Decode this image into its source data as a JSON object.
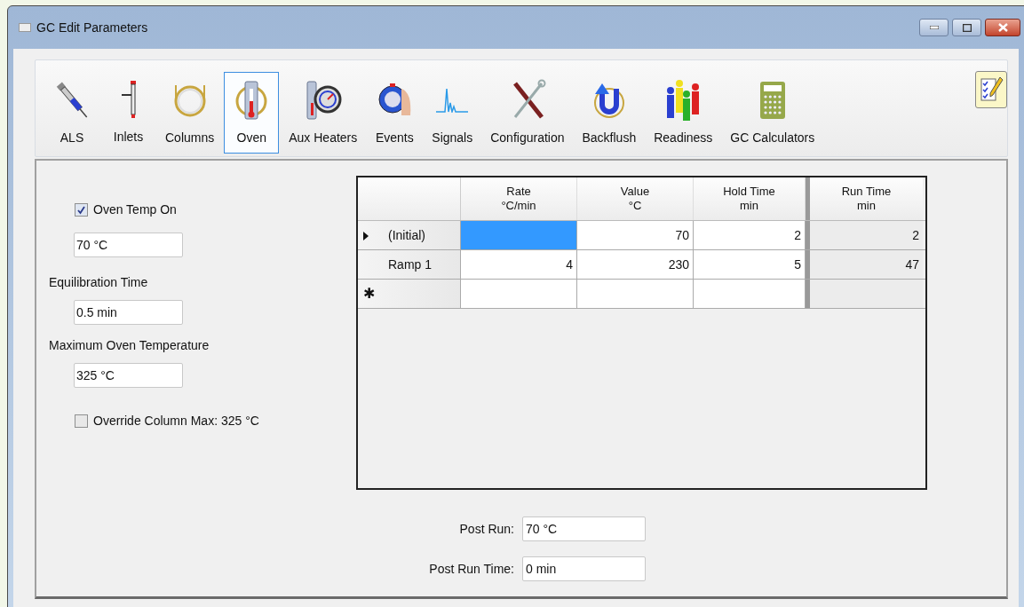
{
  "window": {
    "title": "GC Edit Parameters"
  },
  "toolbar": [
    {
      "label": "ALS",
      "selected": false
    },
    {
      "label": "Inlets",
      "selected": false
    },
    {
      "label": "Columns",
      "selected": false
    },
    {
      "label": "Oven",
      "selected": true
    },
    {
      "label": "Aux Heaters",
      "selected": false
    },
    {
      "label": "Events",
      "selected": false
    },
    {
      "label": "Signals",
      "selected": false
    },
    {
      "label": "Configuration",
      "selected": false
    },
    {
      "label": "Backflush",
      "selected": false
    },
    {
      "label": "Readiness",
      "selected": false
    },
    {
      "label": "GC Calculators",
      "selected": false
    }
  ],
  "oven": {
    "oven_temp_on": {
      "label": "Oven Temp On",
      "checked": true
    },
    "oven_temp": {
      "value": "70 °C"
    },
    "equilibration_time": {
      "label": "Equilibration Time",
      "value": "0.5 min"
    },
    "max_oven_temperature": {
      "label": "Maximum Oven Temperature",
      "value": "325 °C"
    },
    "override_column_max": {
      "label": "Override Column Max: 325 °C",
      "checked": false
    }
  },
  "ramp_table": {
    "columns": [
      {
        "title": "Rate",
        "unit": "°C/min",
        "readonly": false
      },
      {
        "title": "Value",
        "unit": "°C",
        "readonly": false
      },
      {
        "title": "Hold Time",
        "unit": "min",
        "readonly": false
      },
      {
        "title": "Run Time",
        "unit": "min",
        "readonly": true
      }
    ],
    "rows": [
      {
        "label": "(Initial)",
        "kind": "data",
        "current": true,
        "cells": [
          {
            "selected": true
          },
          {
            "value": "70",
            "selected": false
          },
          {
            "value": "2",
            "selected": false
          },
          {
            "value": "2",
            "selected": false
          }
        ]
      },
      {
        "label": "Ramp 1",
        "kind": "data",
        "current": false,
        "cells": [
          {
            "value": "4",
            "selected": false
          },
          {
            "value": "230",
            "selected": false
          },
          {
            "value": "5",
            "selected": false
          },
          {
            "value": "47",
            "selected": false
          }
        ]
      },
      {
        "label": "✱",
        "kind": "new",
        "current": false,
        "cells": [
          {
            "selected": false
          },
          {
            "selected": false
          },
          {
            "selected": false
          },
          {
            "selected": false
          }
        ]
      }
    ]
  },
  "post_run": {
    "label": "Post Run:",
    "value": "70 °C"
  },
  "post_run_time": {
    "label": "Post Run Time:",
    "value": "0 min"
  }
}
